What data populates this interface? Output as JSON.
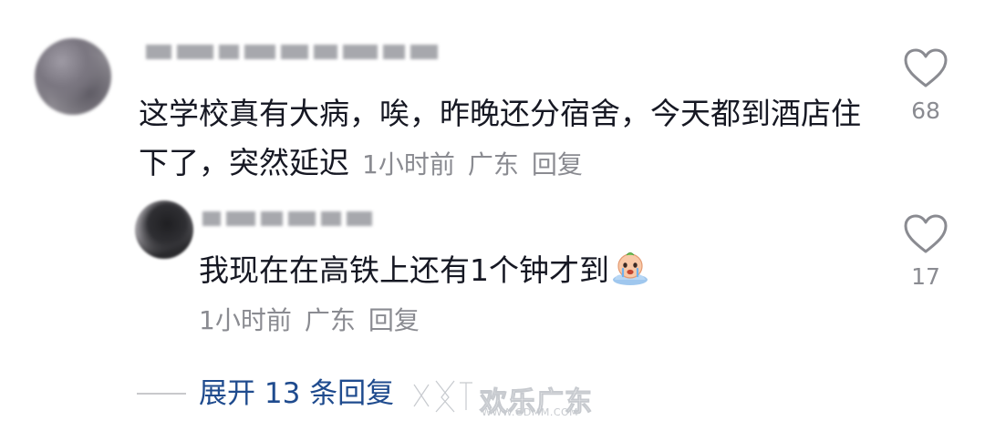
{
  "comment": {
    "text": "这学校真有大病，唉，昨晚还分宿舍，今天都到酒店住下了，突然延迟",
    "time": "1小时前",
    "location": "广东",
    "reply_label": "回复",
    "likes": "68"
  },
  "reply": {
    "text": "我现在在高铁上还有1个钟才到",
    "emoji": "crying-face-emoji",
    "time": "1小时前",
    "location": "广东",
    "reply_label": "回复",
    "likes": "17"
  },
  "expand_replies": {
    "label": "展开 13 条回复"
  },
  "watermark": {
    "text": "欢乐广东",
    "url": "WWW.GDMM.COM"
  },
  "colors": {
    "text": "#161823",
    "meta": "#8a8b91",
    "link": "#1f4b8e"
  }
}
